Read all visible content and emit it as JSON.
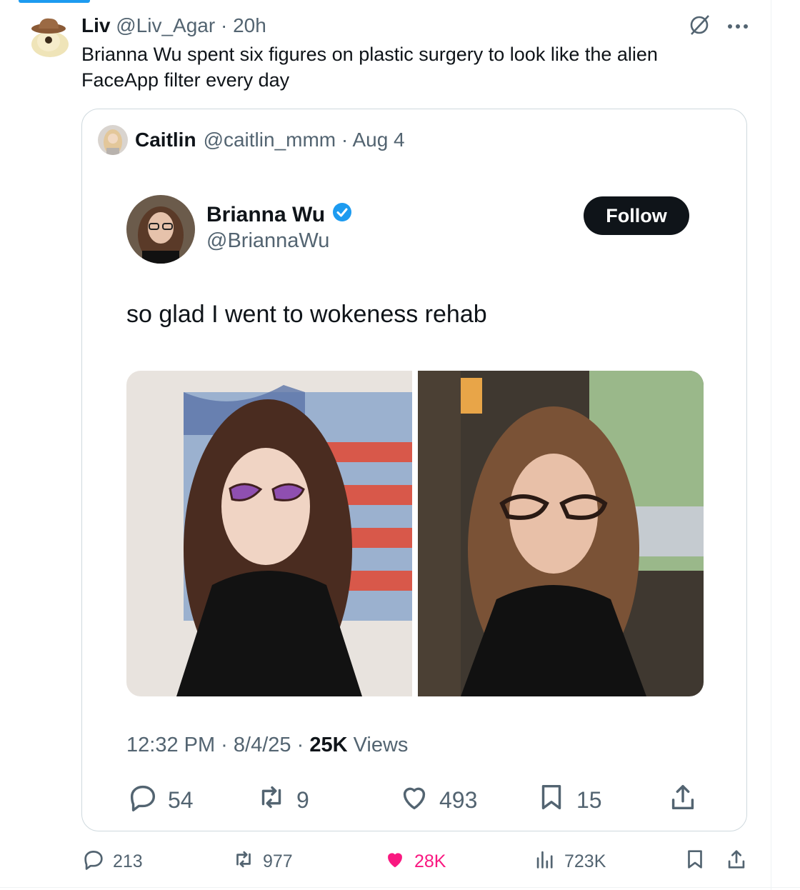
{
  "outer_tweet": {
    "author_name": "Liv",
    "handle_time": "@Liv_Agar · 20h",
    "text": "Brianna Wu spent six figures on plastic surgery to look like the alien FaceApp filter every day",
    "actions": {
      "replies": "213",
      "reposts": "977",
      "likes": "28K",
      "views": "723K"
    }
  },
  "quote": {
    "author_name": "Caitlin",
    "handle_time": "@caitlin_mmm · Aug 4",
    "embedded": {
      "name": "Brianna Wu",
      "handle": "@BriannaWu",
      "follow_label": "Follow",
      "text": "so glad I went to wokeness rehab",
      "timestamp": "12:32 PM · 8/4/25 · ",
      "views_count": "25K",
      "views_label": " Views",
      "actions": {
        "replies": "54",
        "reposts": "9",
        "likes": "493",
        "bookmarks": "15"
      }
    }
  },
  "icons": {
    "grok": "grok-icon",
    "more": "more-icon",
    "verified": "verified-badge-icon",
    "reply": "reply-icon",
    "repost": "repost-icon",
    "like": "heart-icon",
    "views": "views-icon",
    "bookmark": "bookmark-icon",
    "share": "share-icon"
  },
  "colors": {
    "like_active": "#f91880",
    "verified": "#1d9bf0",
    "muted": "#536471",
    "follow_bg": "#0f1419"
  }
}
